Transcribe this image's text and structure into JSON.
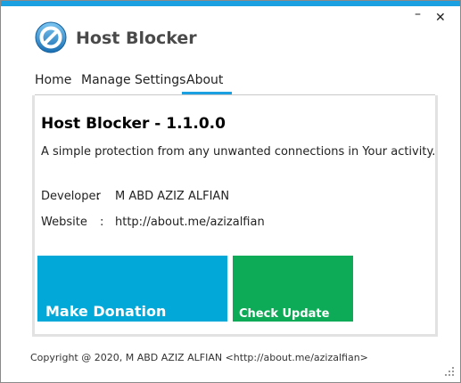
{
  "window": {
    "title": "Host Blocker",
    "minimize": "–",
    "close": "✕",
    "accent_color": "#1ba1e2"
  },
  "app_icon": "blocked-circle-icon",
  "tabs": [
    {
      "label": "Home",
      "active": false
    },
    {
      "label": "Manage",
      "active": false
    },
    {
      "label": "Settings",
      "active": false
    },
    {
      "label": "About",
      "active": true
    }
  ],
  "about": {
    "title": "Host Blocker - 1.1.0.0",
    "description": "A simple protection from any unwanted connections in Your activity.",
    "developer_label": "Developer",
    "developer_value": "M ABD AZIZ ALFIAN",
    "website_label": "Website",
    "website_value": "http://about.me/azizalfian",
    "colon": ":"
  },
  "tiles": {
    "donate_label": "Make Donation",
    "donate_color": "#02a8d8",
    "update_label": "Check Update",
    "update_color": "#0daa57"
  },
  "footer": "Copyright @ 2020, M ABD AZIZ ALFIAN <http://about.me/azizalfian>"
}
